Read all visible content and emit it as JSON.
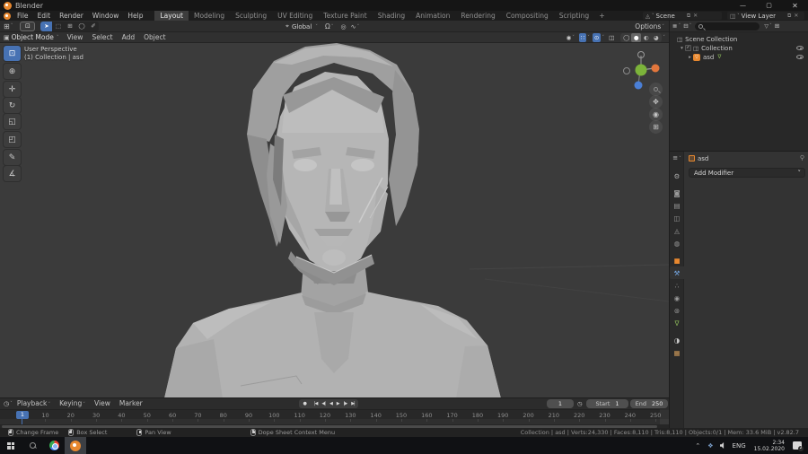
{
  "window": {
    "title": "Blender",
    "controls": [
      {
        "name": "minimize",
        "glyph": "—"
      },
      {
        "name": "maximize",
        "glyph": "▢"
      },
      {
        "name": "close",
        "glyph": "✕"
      }
    ]
  },
  "menubar": {
    "menus": [
      "File",
      "Edit",
      "Render",
      "Window",
      "Help"
    ],
    "workspaces": [
      "Layout",
      "Modeling",
      "Sculpting",
      "UV Editing",
      "Texture Paint",
      "Shading",
      "Animation",
      "Rendering",
      "Compositing",
      "Scripting"
    ],
    "active_workspace": "Layout",
    "add_workspace": "+",
    "scene_label": "Scene",
    "view_layer_label": "View Layer"
  },
  "tool_settings": {
    "select_modes": [
      {
        "name": "tweak",
        "glyph": "➤",
        "active": true
      },
      {
        "name": "select-box",
        "glyph": "⬚",
        "active": false
      },
      {
        "name": "select-box-new",
        "glyph": "⊞",
        "active": false
      },
      {
        "name": "select-circle",
        "glyph": "◯",
        "active": false
      },
      {
        "name": "select-lasso",
        "glyph": "✐",
        "active": false
      }
    ],
    "orientation": "Global",
    "options_label": "Options"
  },
  "viewport": {
    "mode": "Object Mode",
    "menus": [
      "View",
      "Select",
      "Add",
      "Object"
    ],
    "overlay_line1": "User Perspective",
    "overlay_line2": "(1) Collection | asd",
    "tools": [
      {
        "name": "select-box",
        "glyph": "⊡",
        "active": true
      },
      {
        "name": "cursor",
        "glyph": "⊕",
        "active": false
      },
      {
        "name": "move",
        "glyph": "✛",
        "active": false
      },
      {
        "name": "rotate",
        "glyph": "↻",
        "active": false
      },
      {
        "name": "scale",
        "glyph": "◱",
        "active": false
      },
      {
        "name": "transform",
        "glyph": "◰",
        "active": false
      },
      {
        "name": "annotate",
        "glyph": "✎",
        "active": false
      },
      {
        "name": "measure",
        "glyph": "∡",
        "active": false
      }
    ],
    "shading_modes": [
      {
        "name": "wireframe",
        "glyph": "◯",
        "active": false
      },
      {
        "name": "solid",
        "glyph": "●",
        "active": true
      },
      {
        "name": "material-preview",
        "glyph": "◐",
        "active": false
      },
      {
        "name": "rendered",
        "glyph": "◕",
        "active": false
      }
    ]
  },
  "outliner": {
    "rows": [
      {
        "label": "Scene Collection"
      },
      {
        "label": "Collection"
      },
      {
        "label": "asd"
      }
    ]
  },
  "properties": {
    "object_name": "asd",
    "add_modifier_label": "Add Modifier",
    "tabs": [
      {
        "name": "tool",
        "glyph": "⚙",
        "color": "#ababab",
        "active": false
      },
      {
        "name": "render",
        "glyph": "◙",
        "color": "#9a9a9a",
        "active": false
      },
      {
        "name": "output",
        "glyph": "▤",
        "color": "#9a9a9a",
        "active": false
      },
      {
        "name": "view-layer",
        "glyph": "◫",
        "color": "#9a9a9a",
        "active": false
      },
      {
        "name": "scene",
        "glyph": "◬",
        "color": "#9a9a9a",
        "active": false
      },
      {
        "name": "world",
        "glyph": "◍",
        "color": "#9a9a9a",
        "active": false
      },
      {
        "name": "object",
        "glyph": "■",
        "color": "#e8882f",
        "active": false
      },
      {
        "name": "modifiers",
        "glyph": "⚒",
        "color": "#76a9e6",
        "active": true
      },
      {
        "name": "particles",
        "glyph": "∴",
        "color": "#9a9a9a",
        "active": false
      },
      {
        "name": "physics",
        "glyph": "◉",
        "color": "#9a9a9a",
        "active": false
      },
      {
        "name": "constraints",
        "glyph": "⊛",
        "color": "#9a9a9a",
        "active": false
      },
      {
        "name": "object-data",
        "glyph": "∇",
        "color": "#8cba5a",
        "active": false
      },
      {
        "name": "material",
        "glyph": "◑",
        "color": "#c8c8c8",
        "active": false
      },
      {
        "name": "texture",
        "glyph": "▦",
        "color": "#cf9a5a",
        "active": false
      }
    ]
  },
  "timeline": {
    "menus": [
      {
        "label": "Playback",
        "chevron": true
      },
      {
        "label": "Keying",
        "chevron": true
      },
      {
        "label": "View",
        "chevron": false
      },
      {
        "label": "Marker",
        "chevron": false
      }
    ],
    "transport": [
      {
        "name": "auto-keying",
        "glyph": "●"
      },
      {
        "name": "jump-to-start",
        "glyph": "|◀"
      },
      {
        "name": "jump-to-prev-keyframe",
        "glyph": "◀|"
      },
      {
        "name": "play-reverse",
        "glyph": "◀"
      },
      {
        "name": "play",
        "glyph": "▶"
      },
      {
        "name": "jump-to-next-keyframe",
        "glyph": "|▶"
      },
      {
        "name": "jump-to-end",
        "glyph": "▶|"
      }
    ],
    "current_frame": "1",
    "start_label": "Start",
    "start_value": "1",
    "end_label": "End",
    "end_value": "250",
    "ruler_ticks": [
      "10",
      "20",
      "30",
      "40",
      "50",
      "60",
      "70",
      "80",
      "90",
      "100",
      "110",
      "120",
      "130",
      "140",
      "150",
      "160",
      "170",
      "180",
      "190",
      "200",
      "210",
      "220",
      "230",
      "240",
      "250"
    ]
  },
  "status_bar": {
    "hints": [
      {
        "button": "left",
        "label": "Change Frame"
      },
      {
        "button": "left",
        "label": "Box Select"
      },
      {
        "button": "middle",
        "label": "Pan View"
      },
      {
        "button": "right",
        "label": "Dope Sheet Context Menu"
      }
    ],
    "stats": "Collection | asd | Verts:24,330 | Faces:8,110 | Tris:8,110 | Objects:0/1 | Mem: 33.6 MiB | v2.82.7"
  },
  "taskbar": {
    "language": "ENG",
    "time": "2:34",
    "date": "15.02.2020",
    "notification_count": "2"
  },
  "colors": {
    "accent": "#4772b3",
    "object_orange": "#e8882f",
    "axis_x": "#e2763c",
    "axis_y": "#7cb33a",
    "axis_z": "#4a7fd6"
  }
}
